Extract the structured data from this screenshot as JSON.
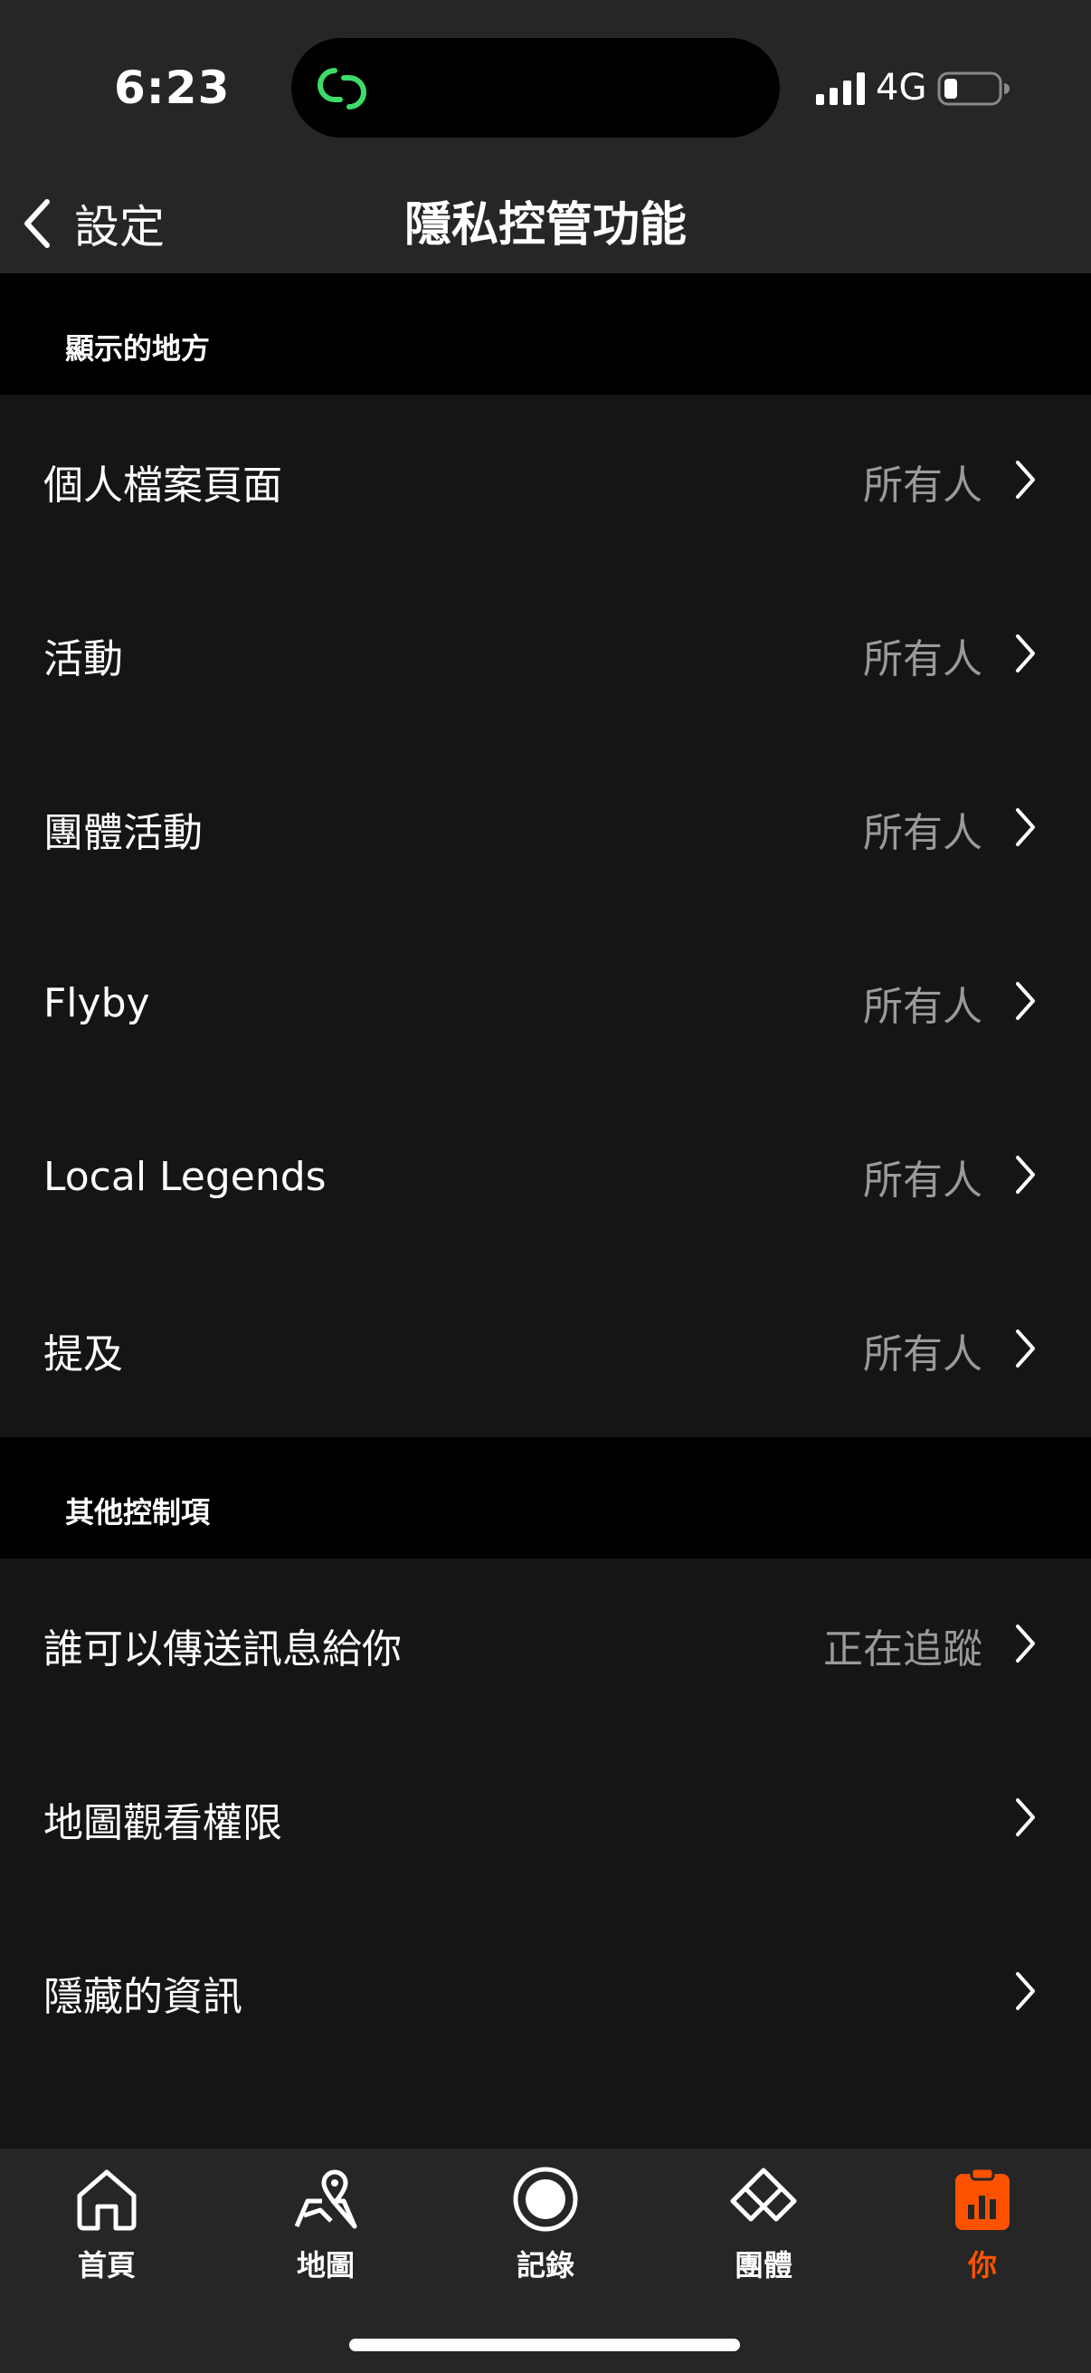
{
  "status_bar": {
    "time": "6:23",
    "network": "4G",
    "island_icon": "link-chain-icon",
    "accent": "#3ddc6a"
  },
  "nav": {
    "back_label": "設定",
    "title": "隱私控管功能"
  },
  "sections": [
    {
      "header": "顯示的地方",
      "rows": [
        {
          "label": "個人檔案頁面",
          "value": "所有人"
        },
        {
          "label": "活動",
          "value": "所有人"
        },
        {
          "label": "團體活動",
          "value": "所有人"
        },
        {
          "label": "Flyby",
          "value": "所有人"
        },
        {
          "label": "Local Legends",
          "value": "所有人"
        },
        {
          "label": "提及",
          "value": "所有人"
        }
      ]
    },
    {
      "header": "其他控制項",
      "rows": [
        {
          "label": "誰可以傳送訊息給你",
          "value": "正在追蹤"
        },
        {
          "label": "地圖觀看權限",
          "value": ""
        },
        {
          "label": "隱藏的資訊",
          "value": ""
        }
      ]
    }
  ],
  "tabbar": {
    "active_color": "#fc5200",
    "tabs": [
      {
        "label": "首頁",
        "icon": "home-icon"
      },
      {
        "label": "地圖",
        "icon": "map-icon"
      },
      {
        "label": "記錄",
        "icon": "record-icon"
      },
      {
        "label": "團體",
        "icon": "groups-icon"
      },
      {
        "label": "你",
        "icon": "you-icon"
      }
    ]
  }
}
